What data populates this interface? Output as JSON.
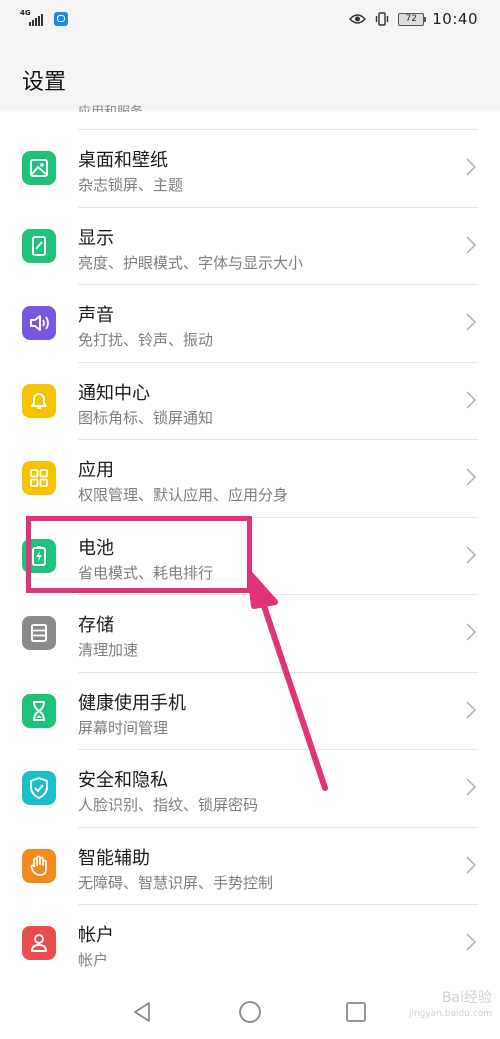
{
  "status_bar": {
    "network": "4G",
    "battery": "72",
    "time": "10:40"
  },
  "header": {
    "title": "设置"
  },
  "scrolled_partial_label": "应用和服务",
  "items": [
    {
      "label": "桌面和壁纸",
      "sub": "杂志锁屏、主题",
      "icon": "wallpaper-icon",
      "color": "#1fc27a"
    },
    {
      "label": "显示",
      "sub": "亮度、护眼模式、字体与显示大小",
      "icon": "display-icon",
      "color": "#1fc27a"
    },
    {
      "label": "声音",
      "sub": "免打扰、铃声、振动",
      "icon": "sound-icon",
      "color": "#7a57e0"
    },
    {
      "label": "通知中心",
      "sub": "图标角标、锁屏通知",
      "icon": "bell-icon",
      "color": "#f5c300"
    },
    {
      "label": "应用",
      "sub": "权限管理、默认应用、应用分身",
      "icon": "apps-icon",
      "color": "#f5c300"
    },
    {
      "label": "电池",
      "sub": "省电模式、耗电排行",
      "icon": "battery-icon",
      "color": "#1fc27a"
    },
    {
      "label": "存储",
      "sub": "清理加速",
      "icon": "storage-icon",
      "color": "#8a8a8a"
    },
    {
      "label": "健康使用手机",
      "sub": "屏幕时间管理",
      "icon": "hourglass-icon",
      "color": "#1fc27a"
    },
    {
      "label": "安全和隐私",
      "sub": "人脸识别、指纹、锁屏密码",
      "icon": "shield-icon",
      "color": "#1bbfc9"
    },
    {
      "label": "智能辅助",
      "sub": "无障碍、智慧识屏、手势控制",
      "icon": "hand-icon",
      "color": "#f28a1e"
    },
    {
      "label": "帐户",
      "sub": "帐户",
      "icon": "account-icon",
      "color": "#ea4b4b"
    }
  ],
  "watermark": {
    "text": "Bai经验",
    "sub": "jingyan.baidu.com"
  },
  "annotation": {
    "color": "#e0337a"
  }
}
